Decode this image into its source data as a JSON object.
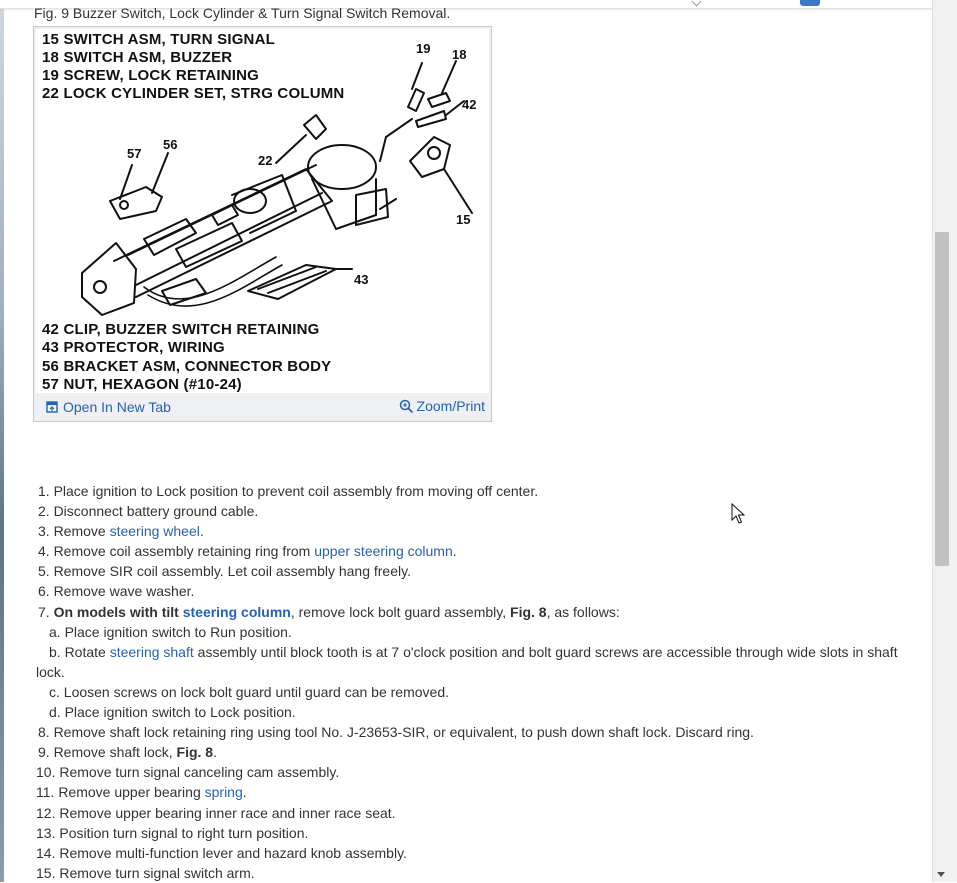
{
  "figure": {
    "caption": "Fig. 9 Buzzer Switch, Lock Cylinder & Turn Signal Switch Removal.",
    "legend_top": [
      "15 SWITCH ASM, TURN SIGNAL",
      "18 SWITCH ASM, BUZZER",
      "19 SCREW, LOCK RETAINING",
      "22 LOCK CYLINDER SET, STRG COLUMN"
    ],
    "legend_bottom": [
      "42 CLIP, BUZZER SWITCH RETAINING",
      "43 PROTECTOR, WIRING",
      "56 BRACKET ASM, CONNECTOR BODY",
      "57 NUT, HEXAGON (#10-24)"
    ],
    "callouts": [
      "19",
      "18",
      "42",
      "57",
      "56",
      "22",
      "15",
      "43"
    ],
    "open_new_tab_label": "Open In New Tab",
    "zoom_print_label": "Zoom/Print",
    "open_icon": "open-in-new-tab-icon",
    "zoom_icon": "magnifier-icon"
  },
  "steps": {
    "s1": "1. Place ignition to Lock position to prevent coil assembly from moving off center.",
    "s2": "2. Disconnect battery ground cable.",
    "s3_pre": "3. Remove ",
    "s3_link": "steering wheel",
    "s3_post": ".",
    "s4_pre": "4. Remove coil assembly retaining ring from ",
    "s4_link": "upper steering column",
    "s4_post": ".",
    "s5": "5. Remove SIR coil assembly. Let coil assembly hang freely.",
    "s6": "6. Remove wave washer.",
    "s7_num": "7. ",
    "s7_bold": "On models with tilt ",
    "s7_link": "steering column",
    "s7_mid": ", remove lock bolt guard assembly, ",
    "s7_fig": "Fig. 8",
    "s7_post": ", as follows:",
    "s7a": "a. Place ignition switch to Run position.",
    "s7b_pre": "b. Rotate ",
    "s7b_link": "steering shaft",
    "s7b_post": " assembly until block tooth is at 7 o'clock position and bolt guard screws are accessible through wide slots in shaft lock.",
    "s7c": "c. Loosen screws on lock bolt guard until guard can be removed.",
    "s7d": "d. Place ignition switch to Lock position.",
    "s8": "8. Remove shaft lock retaining ring using tool No. J-23653-SIR, or equivalent, to push down shaft lock. Discard ring.",
    "s9_pre": "9. Remove shaft lock, ",
    "s9_fig": "Fig. 8",
    "s9_post": ".",
    "s10": "10. Remove turn signal canceling cam assembly.",
    "s11_pre": "11. Remove upper bearing ",
    "s11_link": "spring",
    "s11_post": ".",
    "s12": "12. Remove upper bearing inner race and inner race seat.",
    "s13": "13. Position turn signal to right turn position.",
    "s14": "14. Remove multi-function lever and hazard knob assembly.",
    "s15": "15. Remove turn signal switch arm."
  },
  "colors": {
    "link": "#2762b0",
    "text": "#333333",
    "figure_frame": "#eef0f3"
  }
}
